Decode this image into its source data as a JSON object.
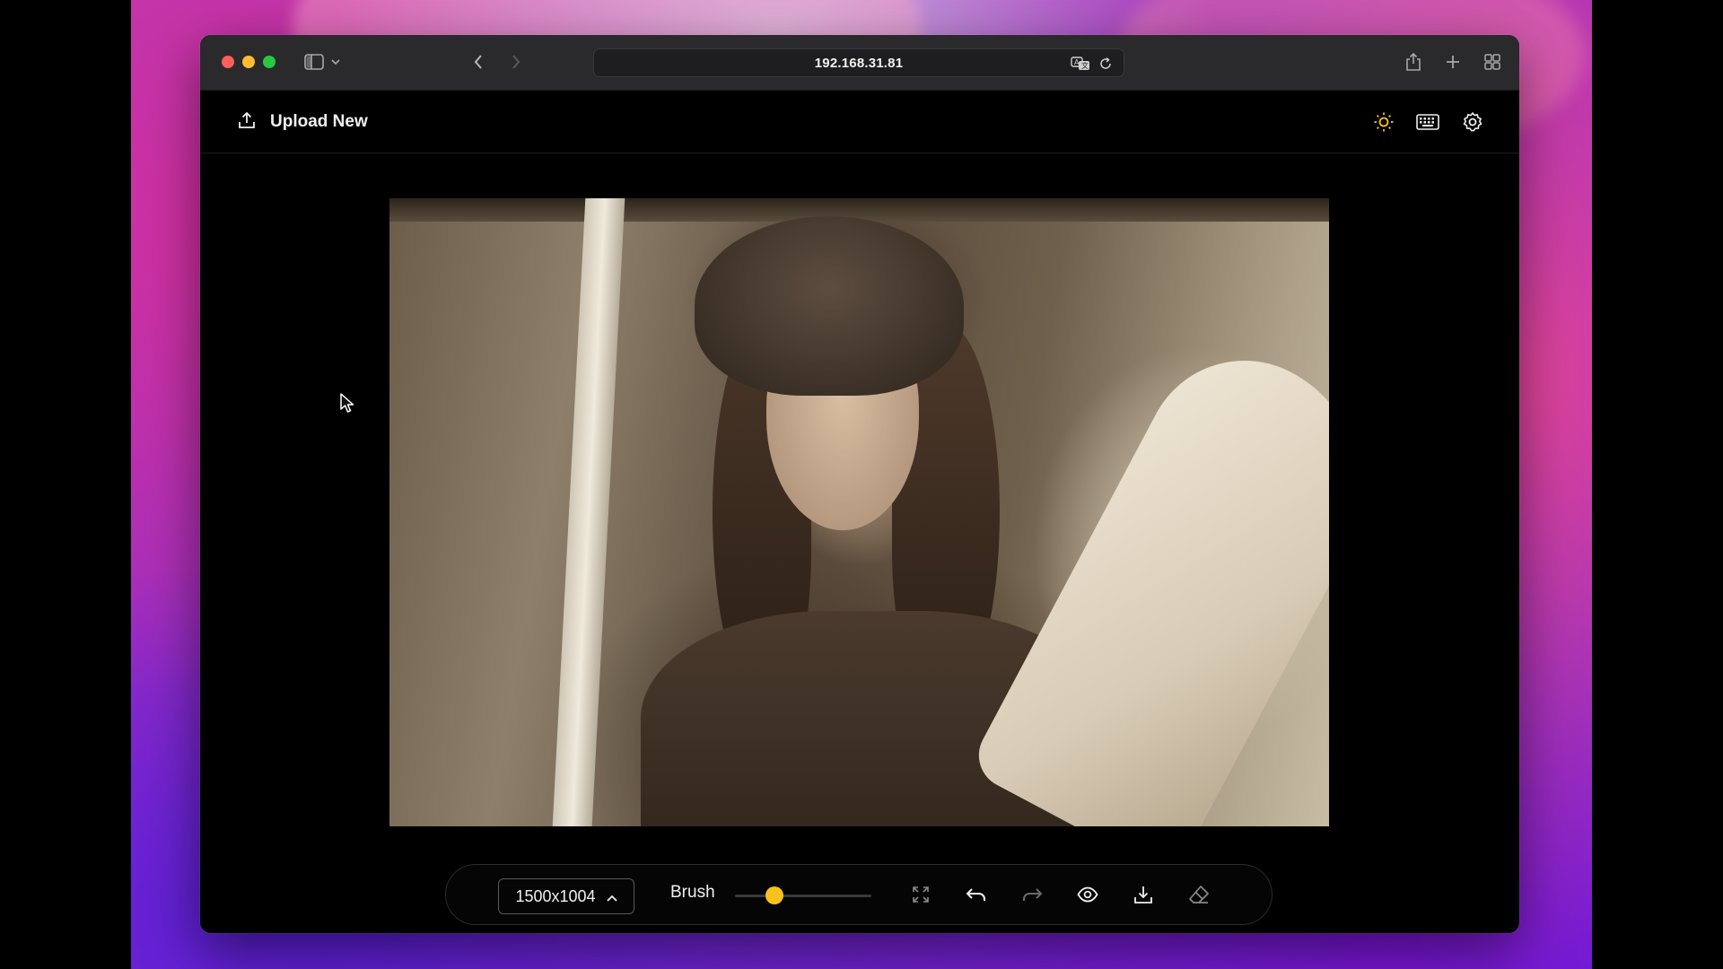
{
  "browser": {
    "url": "192.168.31.81"
  },
  "app": {
    "upload_label": "Upload New"
  },
  "toolbar": {
    "size_value": "1500x1004",
    "brush_label": "Brush",
    "brush_size_fraction": 0.29,
    "accent_color": "#f7c21a"
  },
  "icons": {
    "browser": [
      "sidebar-icon",
      "chevron-down-icon",
      "back-icon",
      "forward-icon",
      "translate-icon",
      "reload-icon",
      "share-icon",
      "new-tab-icon",
      "tab-overview-icon"
    ],
    "header": [
      "upload-icon",
      "sun-icon",
      "keyboard-icon",
      "gear-icon"
    ],
    "toolbar": [
      "chevron-up-icon",
      "fullscreen-icon",
      "undo-icon",
      "redo-icon",
      "eye-icon",
      "download-icon",
      "eraser-icon"
    ]
  }
}
